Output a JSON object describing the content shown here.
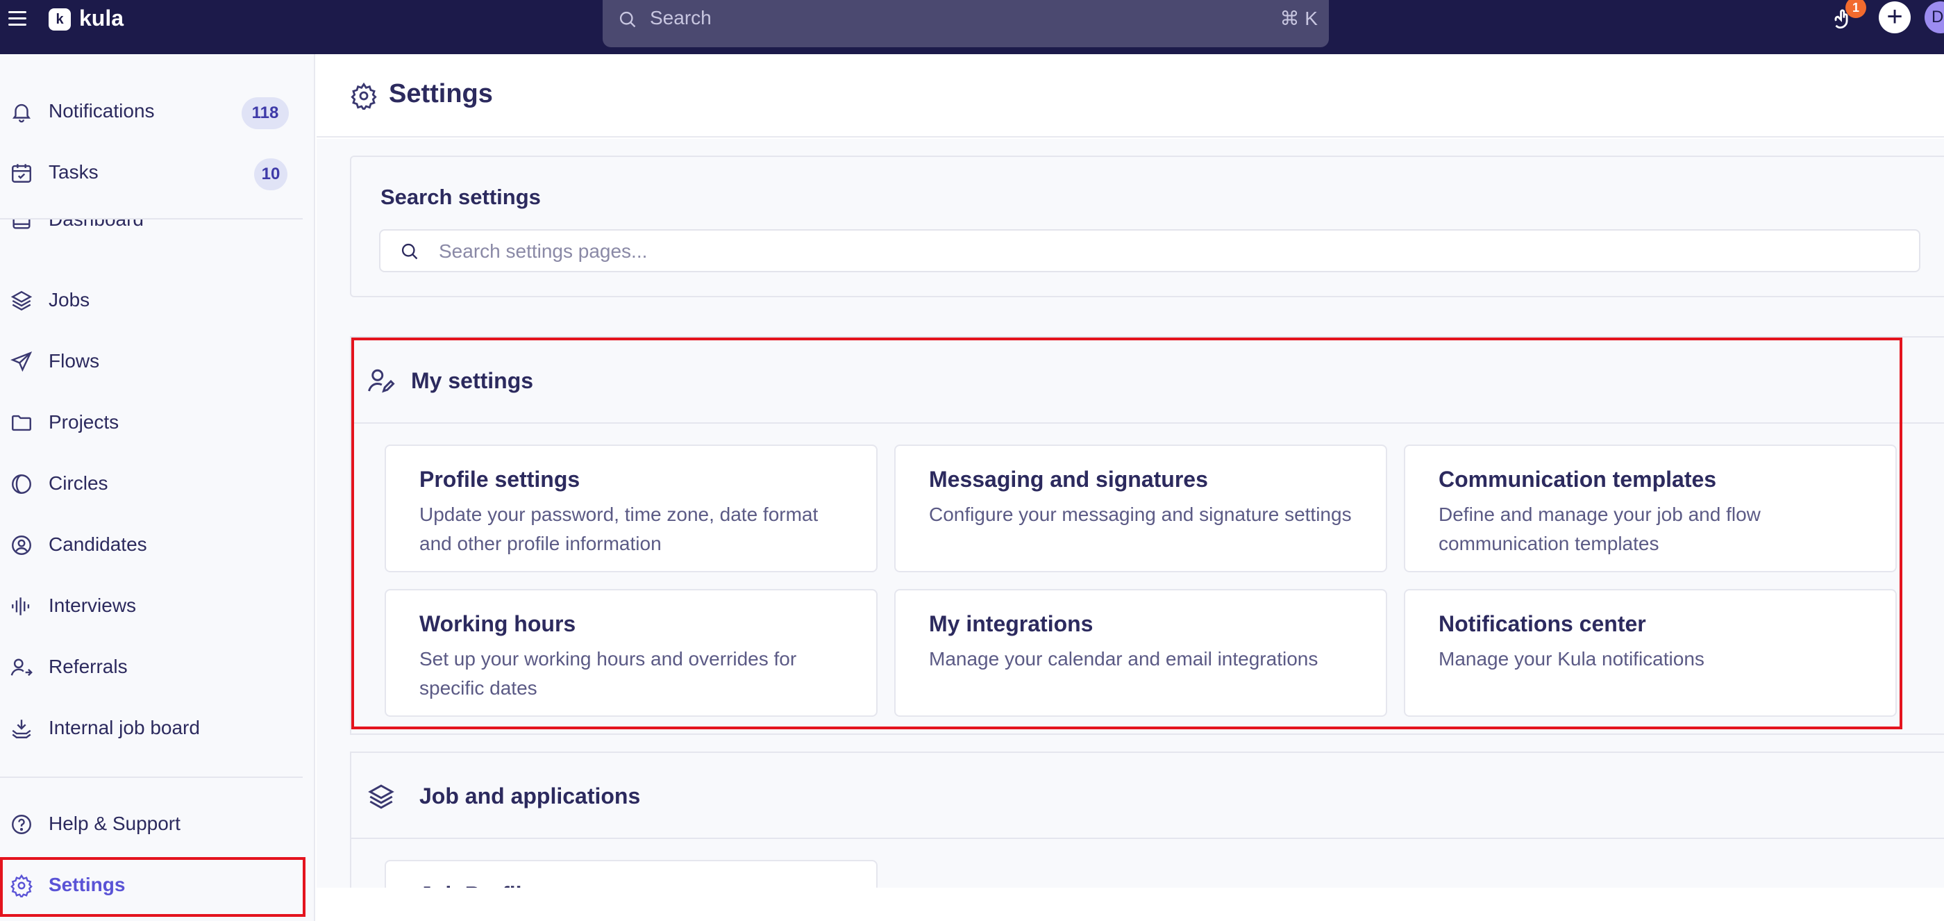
{
  "topbar": {
    "app_name": "kula",
    "logo_glyph": "k",
    "search_placeholder": "Search",
    "search_shortcut": "⌘ K",
    "notification_badge": "1",
    "plus_glyph": "+",
    "avatar_initial": "D"
  },
  "sidebar": {
    "notifications": {
      "label": "Notifications",
      "count": "118"
    },
    "tasks": {
      "label": "Tasks",
      "count": "10"
    },
    "items": [
      {
        "label": "Dashboard",
        "icon": "dashboard-icon"
      },
      {
        "label": "Jobs",
        "icon": "layers-icon"
      },
      {
        "label": "Flows",
        "icon": "send-icon"
      },
      {
        "label": "Projects",
        "icon": "folder-icon"
      },
      {
        "label": "Circles",
        "icon": "circles-icon"
      },
      {
        "label": "Candidates",
        "icon": "user-circle-icon"
      },
      {
        "label": "Interviews",
        "icon": "audio-wave-icon"
      },
      {
        "label": "Referrals",
        "icon": "user-arrow-icon"
      },
      {
        "label": "Internal job board",
        "icon": "inbox-download-icon"
      }
    ],
    "help": "Help & Support",
    "settings": "Settings"
  },
  "main": {
    "title": "Settings",
    "search": {
      "title": "Search settings",
      "placeholder": "Search settings pages..."
    },
    "my_settings": {
      "title": "My settings",
      "tiles": [
        {
          "title": "Profile settings",
          "desc": "Update your password, time zone, date format and other profile information"
        },
        {
          "title": "Messaging and signatures",
          "desc": "Configure your messaging and signature settings"
        },
        {
          "title": "Communication templates",
          "desc": "Define and manage your job and flow communication templates"
        },
        {
          "title": "Working hours",
          "desc": "Set up your working hours and overrides for specific dates"
        },
        {
          "title": "My integrations",
          "desc": "Manage your calendar and email integrations"
        },
        {
          "title": "Notifications center",
          "desc": "Manage your Kula notifications"
        }
      ]
    },
    "job_applications": {
      "title": "Job and applications",
      "partial_tile": "Job Profile"
    }
  },
  "colors": {
    "topbar_bg": "#1c1a4a",
    "accent": "#5a53d6",
    "highlight": "#e4141e",
    "badge": "#f26b2e"
  }
}
